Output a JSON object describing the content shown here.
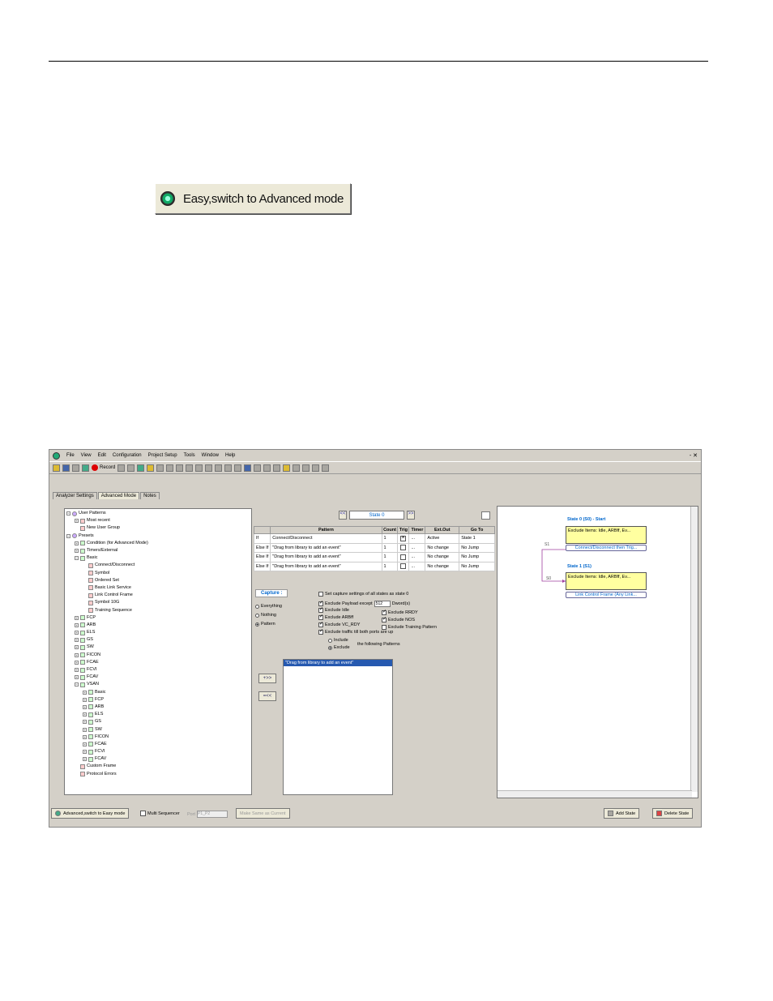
{
  "figure_button": {
    "label": "Easy,switch to Advanced mode"
  },
  "menu": [
    "File",
    "View",
    "Edit",
    "Configuration",
    "Project Setup",
    "Tools",
    "Window",
    "Help"
  ],
  "window_controls": "- ✕",
  "toolbar": {
    "record_label": "Record"
  },
  "tabs": [
    "Analyzer Settings",
    "Advanced Mode",
    "Notes"
  ],
  "tree": [
    {
      "indent": 0,
      "pm": "−",
      "icon": "u",
      "label": "User Patterns"
    },
    {
      "indent": 1,
      "pm": "+",
      "icon": "p",
      "label": "Most recent"
    },
    {
      "indent": 1,
      "pm": "",
      "icon": "p",
      "label": "New User Group"
    },
    {
      "indent": 0,
      "pm": "−",
      "icon": "u",
      "label": "Presets"
    },
    {
      "indent": 1,
      "pm": "+",
      "icon": "g",
      "label": "Condition (for Advanced Mode)"
    },
    {
      "indent": 1,
      "pm": "+",
      "icon": "g",
      "label": "Timers/External"
    },
    {
      "indent": 1,
      "pm": "−",
      "icon": "g",
      "label": "Basic"
    },
    {
      "indent": 2,
      "pm": "",
      "icon": "p",
      "label": "Connect/Disconnect"
    },
    {
      "indent": 2,
      "pm": "",
      "icon": "p",
      "label": "Symbol"
    },
    {
      "indent": 2,
      "pm": "",
      "icon": "p",
      "label": "Ordered Set"
    },
    {
      "indent": 2,
      "pm": "",
      "icon": "p",
      "label": "Basic Link Service"
    },
    {
      "indent": 2,
      "pm": "",
      "icon": "p",
      "label": "Link Control Frame"
    },
    {
      "indent": 2,
      "pm": "",
      "icon": "p",
      "label": "Symbol 10G"
    },
    {
      "indent": 2,
      "pm": "",
      "icon": "p",
      "label": "Training Sequence"
    },
    {
      "indent": 1,
      "pm": "+",
      "icon": "g",
      "label": "FCP"
    },
    {
      "indent": 1,
      "pm": "+",
      "icon": "g",
      "label": "ARB"
    },
    {
      "indent": 1,
      "pm": "+",
      "icon": "g",
      "label": "ELS"
    },
    {
      "indent": 1,
      "pm": "+",
      "icon": "g",
      "label": "GS"
    },
    {
      "indent": 1,
      "pm": "+",
      "icon": "g",
      "label": "SW"
    },
    {
      "indent": 1,
      "pm": "+",
      "icon": "g",
      "label": "FICON"
    },
    {
      "indent": 1,
      "pm": "+",
      "icon": "g",
      "label": "FCAE"
    },
    {
      "indent": 1,
      "pm": "+",
      "icon": "g",
      "label": "FCVI"
    },
    {
      "indent": 1,
      "pm": "+",
      "icon": "g",
      "label": "FCAV"
    },
    {
      "indent": 1,
      "pm": "−",
      "icon": "g",
      "label": "VSAN"
    },
    {
      "indent": 2,
      "pm": "+",
      "icon": "g",
      "label": "Basic"
    },
    {
      "indent": 2,
      "pm": "+",
      "icon": "g",
      "label": "FCP"
    },
    {
      "indent": 2,
      "pm": "+",
      "icon": "g",
      "label": "ARB"
    },
    {
      "indent": 2,
      "pm": "+",
      "icon": "g",
      "label": "ELS"
    },
    {
      "indent": 2,
      "pm": "+",
      "icon": "g",
      "label": "GS"
    },
    {
      "indent": 2,
      "pm": "+",
      "icon": "g",
      "label": "SW"
    },
    {
      "indent": 2,
      "pm": "+",
      "icon": "g",
      "label": "FICON"
    },
    {
      "indent": 2,
      "pm": "+",
      "icon": "g",
      "label": "FCAE"
    },
    {
      "indent": 2,
      "pm": "+",
      "icon": "g",
      "label": "FCVI"
    },
    {
      "indent": 2,
      "pm": "+",
      "icon": "g",
      "label": "FCAV"
    },
    {
      "indent": 1,
      "pm": "",
      "icon": "p",
      "label": "Custom Frame"
    },
    {
      "indent": 1,
      "pm": "",
      "icon": "p",
      "label": "Protocol Errors"
    }
  ],
  "state_nav": {
    "prev": "<<",
    "label": "State 0",
    "next": ">>"
  },
  "pattern_table": {
    "headers": [
      "",
      "Pattern",
      "Count",
      "Trig",
      "Timer",
      "Ext.Out",
      "Go To"
    ],
    "rows": [
      {
        "kind": "If",
        "pattern": "Connect/Disconnect",
        "count": "1",
        "trig": true,
        "timer": "...",
        "extout": "Active",
        "goto": "State 1"
      },
      {
        "kind": "Else If",
        "pattern": "\"Drag from library to add an event\"",
        "count": "1",
        "trig": false,
        "timer": "...",
        "extout": "No change",
        "goto": "No Jump"
      },
      {
        "kind": "Else If",
        "pattern": "\"Drag from library to add an event\"",
        "count": "1",
        "trig": false,
        "timer": "...",
        "extout": "No change",
        "goto": "No Jump"
      },
      {
        "kind": "Else If",
        "pattern": "\"Drag from library to add an event\"",
        "count": "1",
        "trig": false,
        "timer": "...",
        "extout": "No change",
        "goto": "No Jump"
      }
    ]
  },
  "capture": {
    "title": "Capture :",
    "radios": [
      {
        "label": "Everything",
        "on": false
      },
      {
        "label": "Nothing",
        "on": false
      },
      {
        "label": "Pattern",
        "on": true
      }
    ],
    "set_all": "Set capture settings of all states as state 0",
    "payload_label": "Exclude Payload except",
    "payload_value": "512",
    "payload_unit": "Dword(s)",
    "exclude_idle": "Exclude Idle",
    "exclude_arbf": "Exclude ARBff",
    "exclude_vc": "Exclude VC_RDY",
    "exclude_rrdy": "Exclude RRDY",
    "exclude_nos": "Exclude NOS",
    "exclude_training": "Exclude Training Pattern",
    "exclude_traffic": "Exclude traffic till both ports are up",
    "include": "Include",
    "exclude": "Exclude",
    "following": "the following Patterns",
    "list_item": "\"Drag from library to add an event\"",
    "add_btn": "+>>",
    "remove_btn": "=<<"
  },
  "diagram": {
    "s0_title": "State 0 (S0) - Start",
    "s0_box": "Exclude Items: Idle, ARBff, Ev...",
    "s0_link": "Connect/Disconnect then Trig...",
    "label_a": "S1",
    "label_b": "S0",
    "s1_title": "State 1 (S1)",
    "s1_box": "Exclude Items: Idle, ARBff, Ev...",
    "s1_link": "Link Control Frame (Any Link..."
  },
  "bottom": {
    "easy_btn": "Advanced,switch to Easy mode",
    "multi_seq": "Multi Sequencer",
    "port_label": "Port",
    "port_value": "P1_P2",
    "make_same": "Make Same as Current",
    "add_state": "Add State",
    "delete_state": "Delete State"
  }
}
